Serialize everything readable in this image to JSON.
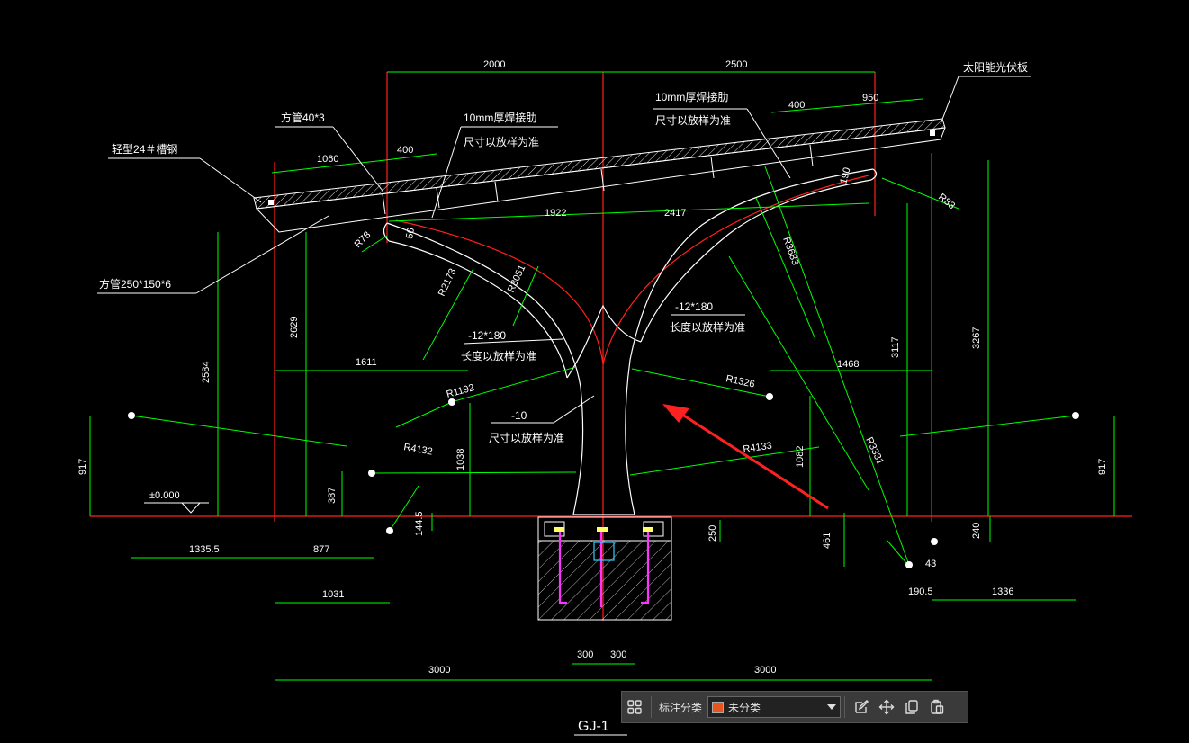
{
  "drawing": {
    "title": "GJ-1",
    "colors": {
      "background": "#000000",
      "dimension": "#00ff00",
      "geometry": "#ffffff",
      "axis": "#ff2020",
      "anchor": "#ff33ff",
      "bolt": "#ffff66",
      "arrow": "#ff2020"
    },
    "elevation_label": "±0.000",
    "dims": {
      "top_2000": "2000",
      "top_2500": "2500",
      "top_400l": "400",
      "top_1060": "1060",
      "top_400r": "400",
      "top_950": "950",
      "mid_1922": "1922",
      "mid_2417": "2417",
      "v_2584": "2584",
      "v_2629": "2629",
      "v_3117": "3117",
      "v_3267": "3267",
      "v_917l": "917",
      "v_917r": "917",
      "v_387": "387",
      "v_1038": "1038",
      "v_1082": "1082",
      "v_144_5": "144.5",
      "v_250": "250",
      "v_461": "461",
      "v_240": "240",
      "v_43": "43",
      "h_1611": "1611",
      "h_1468": "1468",
      "h_1335_5": "1335.5",
      "h_877": "877",
      "h_1031": "1031",
      "h_300l": "300",
      "h_300r": "300",
      "h_3000l": "3000",
      "h_3000r": "3000",
      "h_190_5": "190.5",
      "h_1336": "1336",
      "r_190": "190",
      "r_56": "56"
    },
    "radii": {
      "r78": "R78",
      "r83": "R83",
      "r2173": "R2173",
      "r3051": "R3051",
      "r3683": "R3683",
      "r1192": "R1192",
      "r1326": "R1326",
      "r4132": "R4132",
      "r4133": "R4133",
      "r3331": "R3331"
    },
    "labels": {
      "square_tube_40": "方管40*3",
      "channel_24": "轻型24＃槽钢",
      "plate_10_left_1": "10mm厚焊接肋",
      "plate_10_left_2": "尺寸以放样为准",
      "plate_10_right_1": "10mm厚焊接肋",
      "plate_10_right_2": "尺寸以放样为准",
      "solar_panel": "太阳能光伏板",
      "square_tube_250": "方管250*150*6",
      "plate_12_left_1": "-12*180",
      "plate_12_left_2": "长度以放样为准",
      "plate_12_right_1": "-12*180",
      "plate_12_right_2": "长度以放样为准",
      "plate_10_mid_1": "-10",
      "plate_10_mid_2": "尺寸以放样为准"
    }
  },
  "toolbar": {
    "grid_icon": "grid-icon",
    "category_label": "标注分类",
    "category_value": "未分类",
    "category_color": "#e8541e",
    "edit_icon": "edit-icon",
    "move_icon": "move-icon",
    "copy_icon": "copy-icon",
    "paste_icon": "paste-icon"
  }
}
